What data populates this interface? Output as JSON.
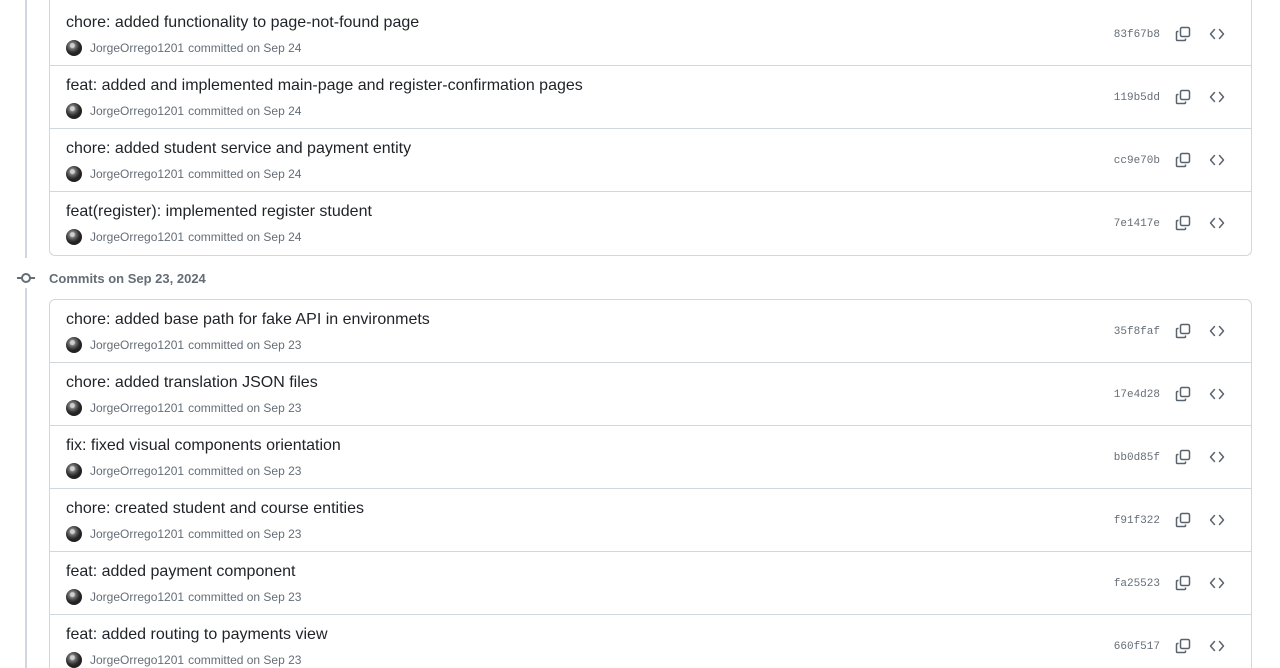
{
  "groups": [
    {
      "header": "",
      "commits": [
        {
          "title": "chore: added functionality to page-not-found page",
          "author": "JorgeOrrego1201",
          "committed": "committed on Sep 24",
          "sha": "83f67b8"
        },
        {
          "title": "feat: added and implemented main-page and register-confirmation pages",
          "author": "JorgeOrrego1201",
          "committed": "committed on Sep 24",
          "sha": "119b5dd"
        },
        {
          "title": "chore: added student service and payment entity",
          "author": "JorgeOrrego1201",
          "committed": "committed on Sep 24",
          "sha": "cc9e70b"
        },
        {
          "title": "feat(register): implemented register student",
          "author": "JorgeOrrego1201",
          "committed": "committed on Sep 24",
          "sha": "7e1417e"
        }
      ]
    },
    {
      "header": "Commits on Sep 23, 2024",
      "commits": [
        {
          "title": "chore: added base path for fake API in environmets",
          "author": "JorgeOrrego1201",
          "committed": "committed on Sep 23",
          "sha": "35f8faf"
        },
        {
          "title": "chore: added translation JSON files",
          "author": "JorgeOrrego1201",
          "committed": "committed on Sep 23",
          "sha": "17e4d28"
        },
        {
          "title": "fix: fixed visual components orientation",
          "author": "JorgeOrrego1201",
          "committed": "committed on Sep 23",
          "sha": "bb0d85f"
        },
        {
          "title": "chore: created student and course entities",
          "author": "JorgeOrrego1201",
          "committed": "committed on Sep 23",
          "sha": "f91f322"
        },
        {
          "title": "feat: added payment component",
          "author": "JorgeOrrego1201",
          "committed": "committed on Sep 23",
          "sha": "fa25523"
        },
        {
          "title": "feat: added routing to payments view",
          "author": "JorgeOrrego1201",
          "committed": "committed on Sep 23",
          "sha": "660f517"
        }
      ]
    }
  ],
  "icons": {
    "copy": "copy-icon",
    "browse": "code-icon",
    "node": "git-commit-icon"
  },
  "colors": {
    "border": "#d0d7de",
    "muted": "#656d76",
    "text": "#1f2328"
  }
}
